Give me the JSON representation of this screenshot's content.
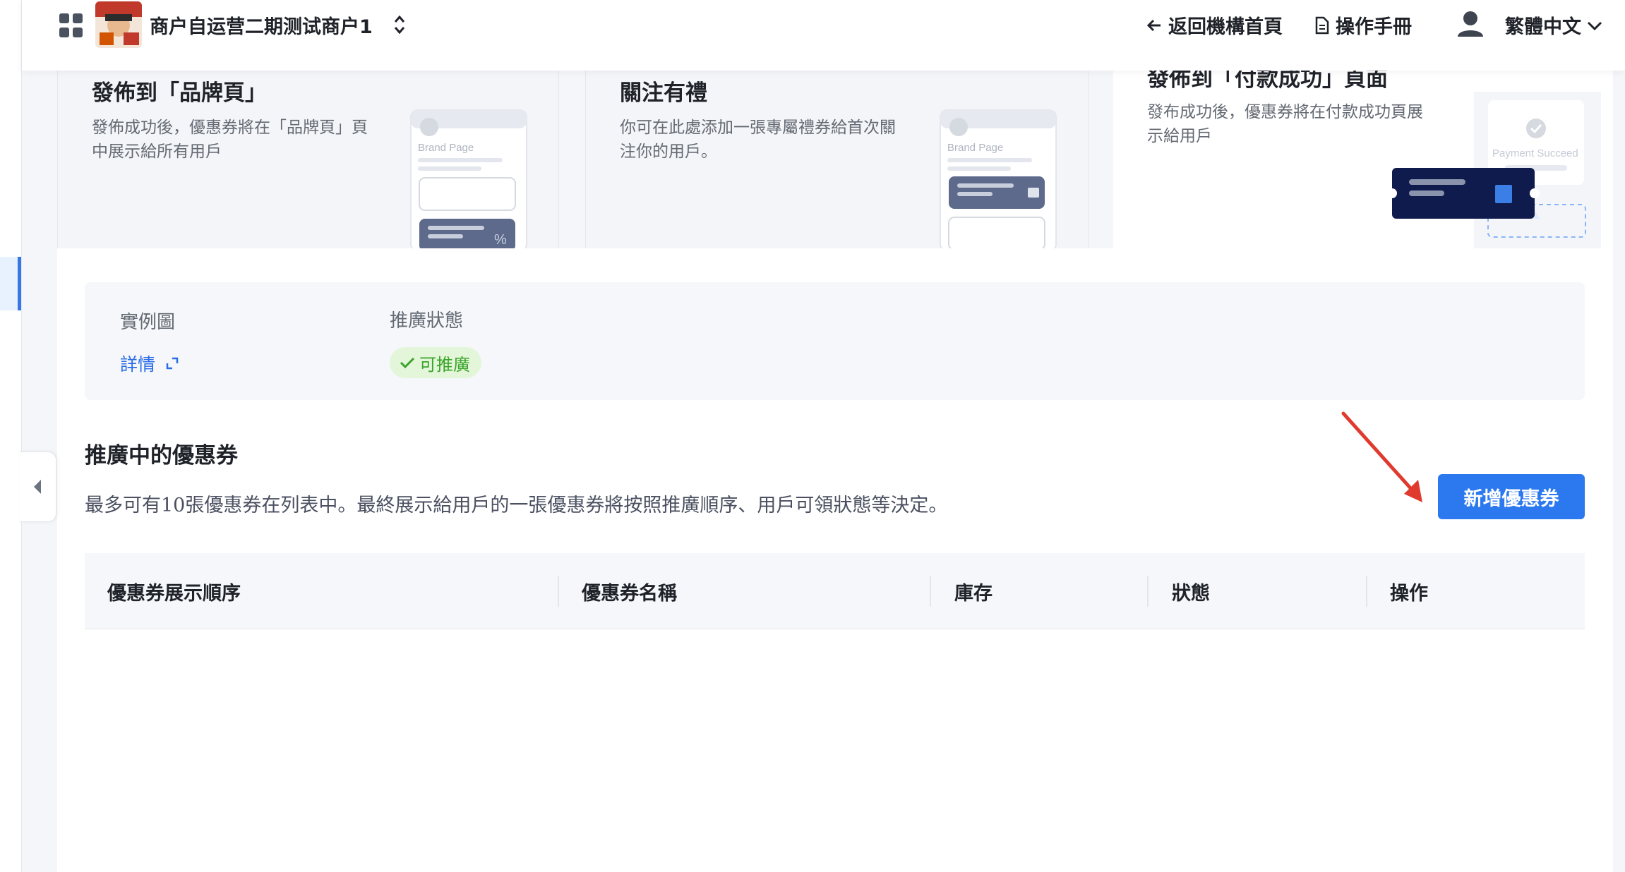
{
  "header": {
    "merchant_name": "商户自运营二期测试商户1",
    "back_label": "返回機構首頁",
    "manual_label": "操作手冊",
    "language": "繁體中文"
  },
  "promo_cards": [
    {
      "title": "發佈到「品牌頁」",
      "description": "發佈成功後，優惠券將在「品牌頁」頁中展示給所有用戶",
      "illus_label": "Brand Page"
    },
    {
      "title": "關注有禮",
      "description": "你可在此處添加一張專屬禮券給首次關注你的用戶。",
      "illus_label": "Brand Page"
    },
    {
      "title": "發佈到「付款成功」頁面",
      "description": "發布成功後，優惠券將在付款成功頁展示給用戶",
      "illus_label": "Payment Succeed"
    }
  ],
  "info": {
    "example_label": "實例圖",
    "detail_link": "詳情",
    "status_label": "推廣狀態",
    "status_value": "可推廣"
  },
  "section": {
    "title": "推廣中的優惠券",
    "description": "最多可有10張優惠券在列表中。最終展示給用戶的一張優惠券將按照推廣順序、用戶可領狀態等決定。",
    "add_button": "新增優惠券"
  },
  "table": {
    "columns": [
      "優惠券展示順序",
      "優惠券名稱",
      "庫存",
      "狀態",
      "操作"
    ],
    "rows": []
  },
  "colors": {
    "accent": "#2b78ef",
    "success_bg": "#e3f6d9",
    "success_text": "#3aa42a",
    "annotation_arrow": "#e03a2f"
  }
}
